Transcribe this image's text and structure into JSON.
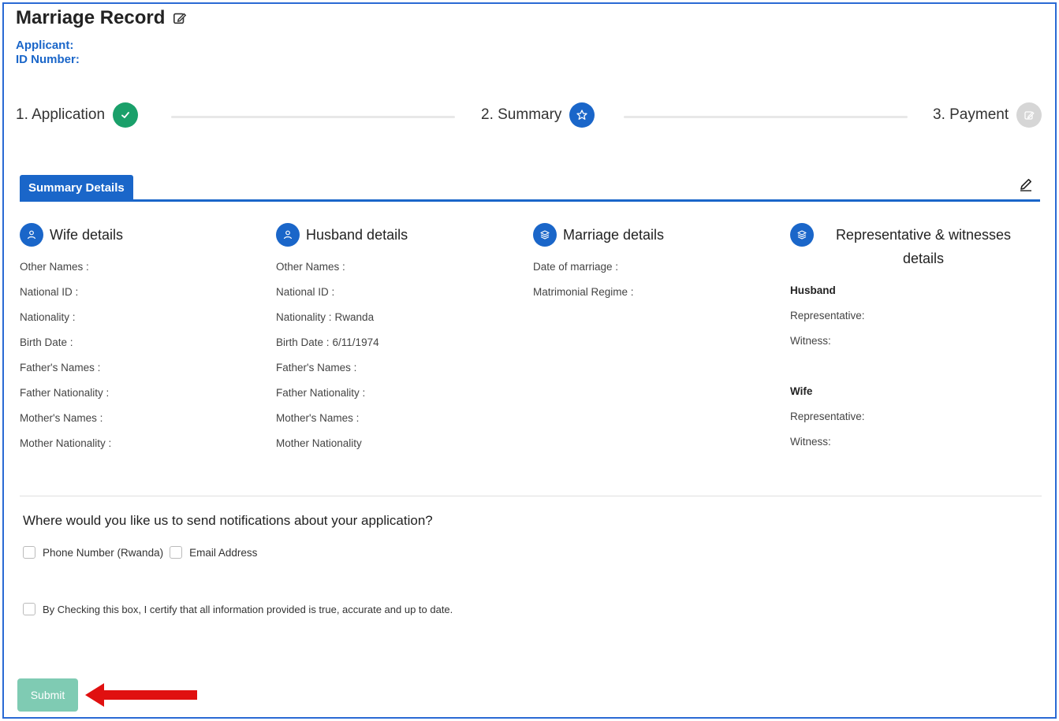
{
  "header": {
    "title": "Marriage Record",
    "applicant_label": "Applicant:",
    "id_label": "ID Number:"
  },
  "stepper": {
    "steps": [
      {
        "label": "1. Application",
        "state": "completed",
        "icon": "check-icon"
      },
      {
        "label": "2. Summary",
        "state": "active",
        "icon": "star-icon"
      },
      {
        "label": "3. Payment",
        "state": "pending",
        "icon": "edit-icon"
      }
    ]
  },
  "tabs": {
    "active_label": "Summary Details"
  },
  "wife": {
    "title": "Wife details",
    "fields": [
      {
        "label": "Other Names :",
        "value": ""
      },
      {
        "label": "National ID :",
        "value": ""
      },
      {
        "label": "Nationality :",
        "value": ""
      },
      {
        "label": "Birth Date :",
        "value": ""
      },
      {
        "label": "Father's Names :",
        "value": ""
      },
      {
        "label": "Father Nationality :",
        "value": ""
      },
      {
        "label": "Mother's Names :",
        "value": ""
      },
      {
        "label": "Mother Nationality :",
        "value": ""
      }
    ]
  },
  "husband": {
    "title": "Husband details",
    "fields": [
      {
        "label": "Other Names :",
        "value": ""
      },
      {
        "label": "National ID :",
        "value": ""
      },
      {
        "label": "Nationality :",
        "value": "Rwanda"
      },
      {
        "label": "Birth Date :",
        "value": "6/11/1974"
      },
      {
        "label": "Father's Names :",
        "value": ""
      },
      {
        "label": "Father Nationality :",
        "value": ""
      },
      {
        "label": "Mother's Names :",
        "value": ""
      },
      {
        "label": "Mother Nationality",
        "value": ""
      }
    ]
  },
  "marriage": {
    "title": "Marriage details",
    "fields": [
      {
        "label": "Date of marriage :",
        "value": ""
      },
      {
        "label": "Matrimonial Regime :",
        "value": ""
      }
    ]
  },
  "witnesses": {
    "title": "Representative & witnesses details",
    "husband_label": "Husband",
    "wife_label": "Wife",
    "representative_label": "Representative:",
    "witness_label": "Witness:"
  },
  "notifications": {
    "question": "Where would you like us to send notifications about your application?",
    "phone_label": "Phone Number (Rwanda)",
    "email_label": "Email Address",
    "certify_label": "By Checking this box, I certify that all information provided is true, accurate and up to date."
  },
  "actions": {
    "submit_label": "Submit"
  },
  "colors": {
    "primary": "#1a66c9",
    "success": "#1aa06a",
    "pending": "#d6d6d6",
    "submit_disabled": "#7fcbb3",
    "annotation_arrow": "#e01010"
  }
}
